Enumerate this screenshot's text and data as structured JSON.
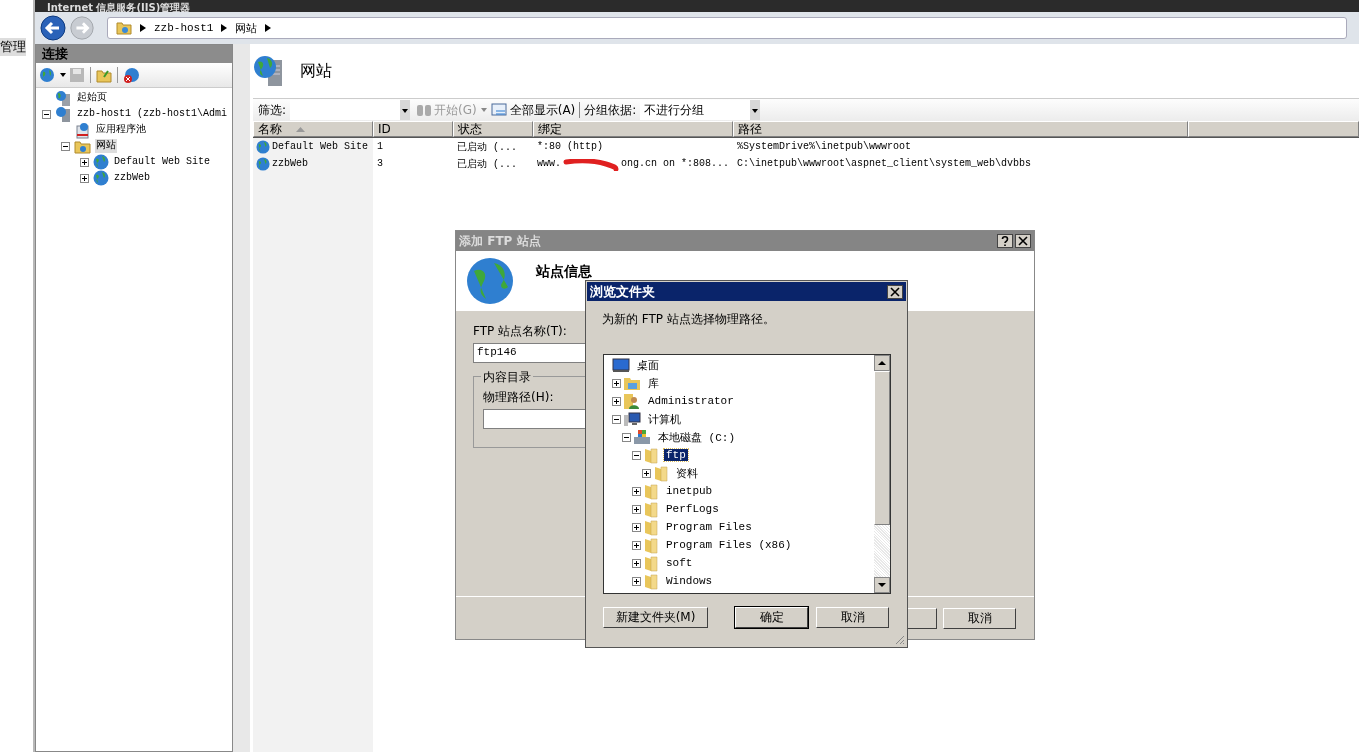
{
  "window": {
    "title": "Internet 信息服务(IIS)管理器"
  },
  "side_label": "管理",
  "address": {
    "crumbs": [
      "zzb-host1",
      "网站"
    ]
  },
  "connections": {
    "title": "连接",
    "tree": [
      {
        "label": "起始页",
        "kind": "start",
        "selected": false
      },
      {
        "label": "zzb-host1 (zzb-host1\\Admi",
        "kind": "server",
        "expanded": true,
        "selected": false,
        "children": [
          {
            "label": "应用程序池",
            "kind": "pool",
            "selected": false
          },
          {
            "label": "网站",
            "kind": "sites",
            "expanded": true,
            "selected": true,
            "children": [
              {
                "label": "Default Web Site",
                "kind": "site",
                "expanded": false,
                "selected": false
              },
              {
                "label": "zzbWeb",
                "kind": "site",
                "expanded": false,
                "selected": false
              }
            ]
          }
        ]
      }
    ]
  },
  "page": {
    "title": "网站",
    "toolbar": {
      "filter_label": "筛选:",
      "start": {
        "label": "开始(G)",
        "disabled": true
      },
      "show_all": "全部显示(A)",
      "group_label": "分组依据:",
      "group_value": "不进行分组"
    },
    "table": {
      "columns": [
        {
          "label": "名称",
          "sorted": true
        },
        {
          "label": "ID",
          "sorted": false
        },
        {
          "label": "状态",
          "sorted": false
        },
        {
          "label": "绑定",
          "sorted": false
        },
        {
          "label": "路径",
          "sorted": false
        }
      ],
      "rows": [
        {
          "name": "Default Web Site",
          "id": "1",
          "status": "已启动 (...",
          "binding": "*:80 (http)",
          "path": "%SystemDrive%\\inetpub\\wwwroot",
          "redacted": false
        },
        {
          "name": "zzbWeb",
          "id": "3",
          "status": "已启动 (...",
          "binding": "www.          ong.cn on *:808...",
          "path": "C:\\inetpub\\wwwroot\\aspnet_client\\system_web\\dvbbs",
          "redacted": true
        }
      ]
    }
  },
  "add_ftp_dialog": {
    "title": "添加 FTP 站点",
    "heading": "站点信息",
    "name_label": "FTP 站点名称(T):",
    "name_value": "ftp146",
    "group_title": "内容目录",
    "path_label": "物理路径(H):",
    "cancel": "取消"
  },
  "browse_dialog": {
    "title": "浏览文件夹",
    "instruction": "为新的 FTP 站点选择物理路径。",
    "tree": [
      {
        "label": "桌面",
        "kind": "desktop",
        "selected": false
      },
      {
        "label": "库",
        "kind": "library",
        "expanded": false,
        "selected": false
      },
      {
        "label": "Administrator",
        "kind": "user",
        "expanded": false,
        "selected": false
      },
      {
        "label": "计算机",
        "kind": "computer",
        "expanded": true,
        "selected": false,
        "children": [
          {
            "label": "本地磁盘 (C:)",
            "kind": "drive",
            "expanded": true,
            "selected": false,
            "children": [
              {
                "label": "ftp",
                "kind": "folder",
                "expanded": true,
                "selected": true,
                "children": [
                  {
                    "label": "资料",
                    "kind": "folder",
                    "expanded": false,
                    "selected": false
                  }
                ]
              },
              {
                "label": "inetpub",
                "kind": "folder",
                "expanded": false,
                "selected": false
              },
              {
                "label": "PerfLogs",
                "kind": "folder",
                "expanded": false,
                "selected": false
              },
              {
                "label": "Program Files",
                "kind": "folder",
                "expanded": false,
                "selected": false
              },
              {
                "label": "Program Files (x86)",
                "kind": "folder",
                "expanded": false,
                "selected": false
              },
              {
                "label": "soft",
                "kind": "folder",
                "expanded": false,
                "selected": false
              },
              {
                "label": "Windows",
                "kind": "folder",
                "expanded": false,
                "selected": false
              }
            ]
          }
        ]
      }
    ],
    "buttons": [
      {
        "label": "新建文件夹(M)",
        "default": false
      },
      {
        "label": "确定",
        "default": true
      },
      {
        "label": "取消",
        "default": false
      }
    ]
  }
}
